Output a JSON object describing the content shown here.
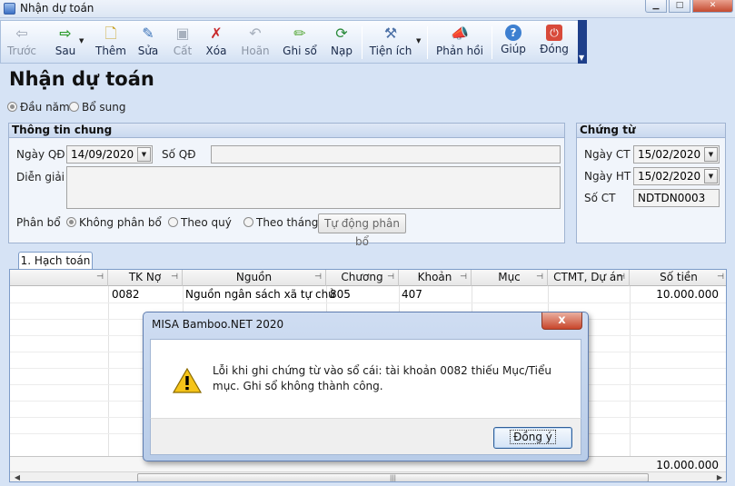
{
  "window": {
    "title": "Nhận dự toán"
  },
  "toolbar": {
    "buttons": [
      {
        "id": "prev",
        "label": "Trước",
        "icon": "arrow-left-icon",
        "disabled": true
      },
      {
        "id": "next",
        "label": "Sau",
        "icon": "arrow-right-icon",
        "disabled": false
      },
      {
        "id": "add",
        "label": "Thêm",
        "icon": "add-document-icon",
        "disabled": false
      },
      {
        "id": "edit",
        "label": "Sửa",
        "icon": "edit-icon",
        "disabled": false
      },
      {
        "id": "save",
        "label": "Cất",
        "icon": "floppy-disk-icon",
        "disabled": true
      },
      {
        "id": "delete",
        "label": "Xóa",
        "icon": "delete-icon",
        "disabled": false
      },
      {
        "id": "undo",
        "label": "Hoãn",
        "icon": "undo-icon",
        "disabled": true
      },
      {
        "id": "post",
        "label": "Ghi sổ",
        "icon": "pencil-icon",
        "disabled": false
      },
      {
        "id": "reload",
        "label": "Nạp",
        "icon": "refresh-icon",
        "disabled": false
      },
      {
        "id": "utilities",
        "label": "Tiện ích",
        "icon": "tools-icon",
        "disabled": false
      },
      {
        "id": "feedback",
        "label": "Phản hồi",
        "icon": "megaphone-icon",
        "disabled": false
      },
      {
        "id": "help",
        "label": "Giúp",
        "icon": "help-icon",
        "disabled": false
      },
      {
        "id": "close",
        "label": "Đóng",
        "icon": "power-icon",
        "disabled": false
      }
    ]
  },
  "page": {
    "title": "Nhận dự toán",
    "type_options": [
      {
        "label": "Đầu năm",
        "checked": true
      },
      {
        "label": "Bổ sung",
        "checked": false
      }
    ]
  },
  "general_info": {
    "header": "Thông tin chung",
    "decision_date_label": "Ngày QĐ",
    "decision_date_value": "14/09/2020",
    "decision_no_label": "Số QĐ",
    "decision_no_value": "",
    "description_label": "Diễn giải",
    "description_value": "",
    "allocation_label": "Phân bổ",
    "allocation_options": [
      {
        "label": "Không phân bổ",
        "checked": true
      },
      {
        "label": "Theo quý",
        "checked": false
      },
      {
        "label": "Theo tháng",
        "checked": false
      }
    ],
    "auto_allocate_button": "Tự động phân bổ"
  },
  "voucher": {
    "header": "Chứng từ",
    "voucher_date_label": "Ngày CT",
    "voucher_date_value": "15/02/2020",
    "accounting_date_label": "Ngày HT",
    "accounting_date_value": "15/02/2020",
    "voucher_no_label": "Số CT",
    "voucher_no_value": "NDTDN0003"
  },
  "tabs": [
    {
      "label": "1. Hạch toán"
    }
  ],
  "grid": {
    "columns": [
      "TK Nợ",
      "Nguồn",
      "Chương",
      "Khoản",
      "Mục",
      "CTMT, Dự án",
      "Số tiền"
    ],
    "rows": [
      {
        "debit_account": "0082",
        "source": "Nguồn ngân sách xã tự chủ",
        "chapter": "805",
        "item": "407",
        "sub_item": "",
        "project": "",
        "amount": "10.000.000"
      }
    ],
    "total_amount": "10.000.000"
  },
  "dialog": {
    "title": "MISA Bamboo.NET 2020",
    "message": "Lỗi khi ghi chứng từ vào sổ cái: tài khoản 0082 thiếu Mục/Tiểu mục. Ghi sổ không thành công.",
    "ok_label": "Đồng ý",
    "close_symbol": "x",
    "icon": "warning-icon"
  }
}
